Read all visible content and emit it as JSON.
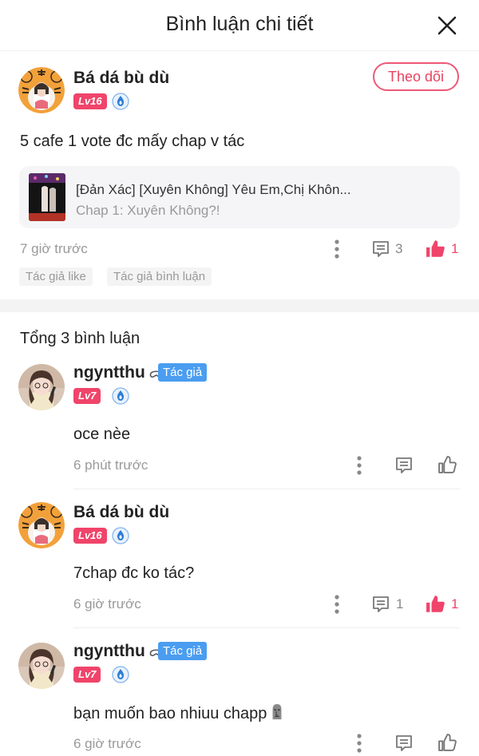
{
  "header": {
    "title": "Bình luận chi tiết"
  },
  "main_comment": {
    "user": "Bá dá bù dù",
    "level": "Lv16",
    "follow_label": "Theo dõi",
    "text": "5 cafe 1 vote đc mấy chap v tác",
    "chapter": {
      "title": "[Đản Xác] [Xuyên Không] Yêu Em,Chị Khôn...",
      "subtitle": "Chap 1: Xuyên Không?!"
    },
    "time": "7 giờ trước",
    "reply_count": "3",
    "like_count": "1",
    "tags": [
      "Tác giả like",
      "Tác giả bình luận"
    ]
  },
  "replies_heading": "Tổng 3 bình luận",
  "replies": [
    {
      "user": "ngyntthu",
      "author_tag": "Tác giả",
      "level": "Lv7",
      "text": "oce nèe",
      "time": "6 phút trước"
    },
    {
      "user": "Bá dá bù dù",
      "level": "Lv16",
      "text": "7chap đc ko tác?",
      "time": "6 giờ trước",
      "reply_count": "1",
      "like_count": "1"
    },
    {
      "user": "ngyntthu",
      "author_tag": "Tác giả",
      "level": "Lv7",
      "text": "bạn muốn bao nhiuu chapp",
      "time": "6 giờ trước"
    }
  ],
  "colors": {
    "accent": "#f0446a",
    "author_tag": "#4a9df0",
    "muted": "#999999"
  }
}
